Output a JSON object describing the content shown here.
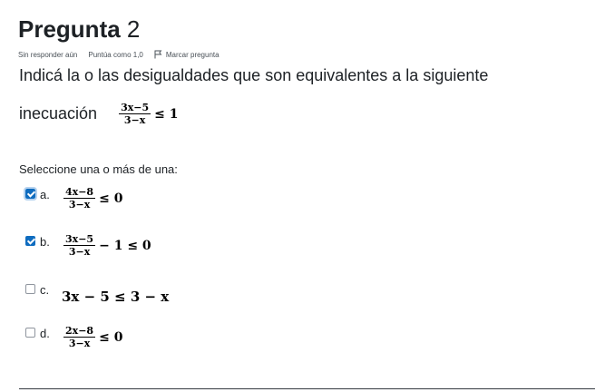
{
  "question": {
    "label": "Pregunta",
    "number": "2",
    "status": "Sin responder aún",
    "grade": "Puntúa como 1,0",
    "flag_label": "Marcar pregunta",
    "text_line1": "Indicá la o las desigualdades que son equivalentes a la siguiente",
    "text_line2": "inecuación",
    "main_numerator": "3x−5",
    "main_denominator": "3−x",
    "main_relation": "≤ 1",
    "prompt": "Seleccione una o más de una:"
  },
  "options": [
    {
      "letter": "a.",
      "checked": true,
      "numerator": "4x−8",
      "denominator": "3−x",
      "relation": "≤ 0"
    },
    {
      "letter": "b.",
      "checked": true,
      "numerator": "3x−5",
      "denominator": "3−x",
      "relation": "− 1 ≤ 0"
    },
    {
      "letter": "c.",
      "checked": false,
      "expression": "3x − 5 ≤ 3 − x"
    },
    {
      "letter": "d.",
      "checked": false,
      "numerator": "2x−8",
      "denominator": "3−x",
      "relation": "≤ 0"
    }
  ],
  "colors": {
    "accent": "#0f6cbf",
    "text": "#1d2125",
    "muted": "#495057"
  }
}
